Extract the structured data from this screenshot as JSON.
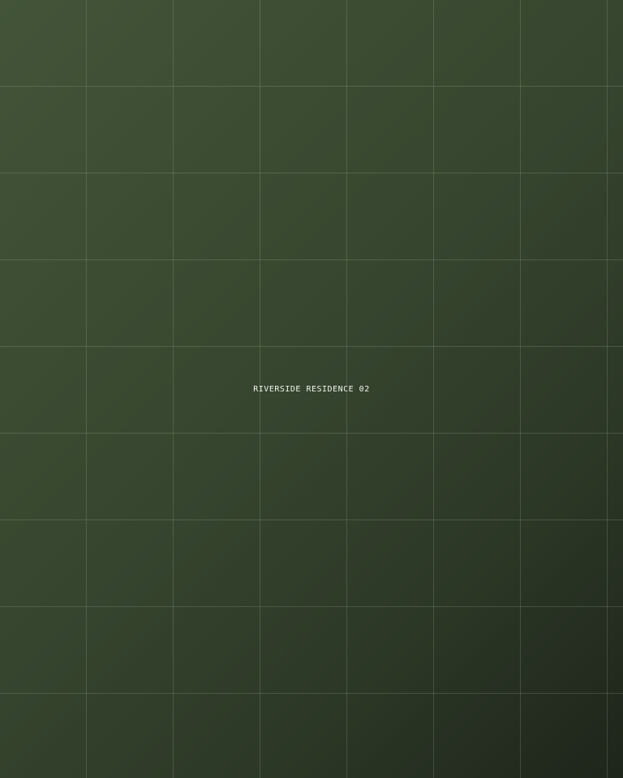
{
  "placeholder": {
    "label": "RIVERSIDE RESIDENCE 02"
  }
}
